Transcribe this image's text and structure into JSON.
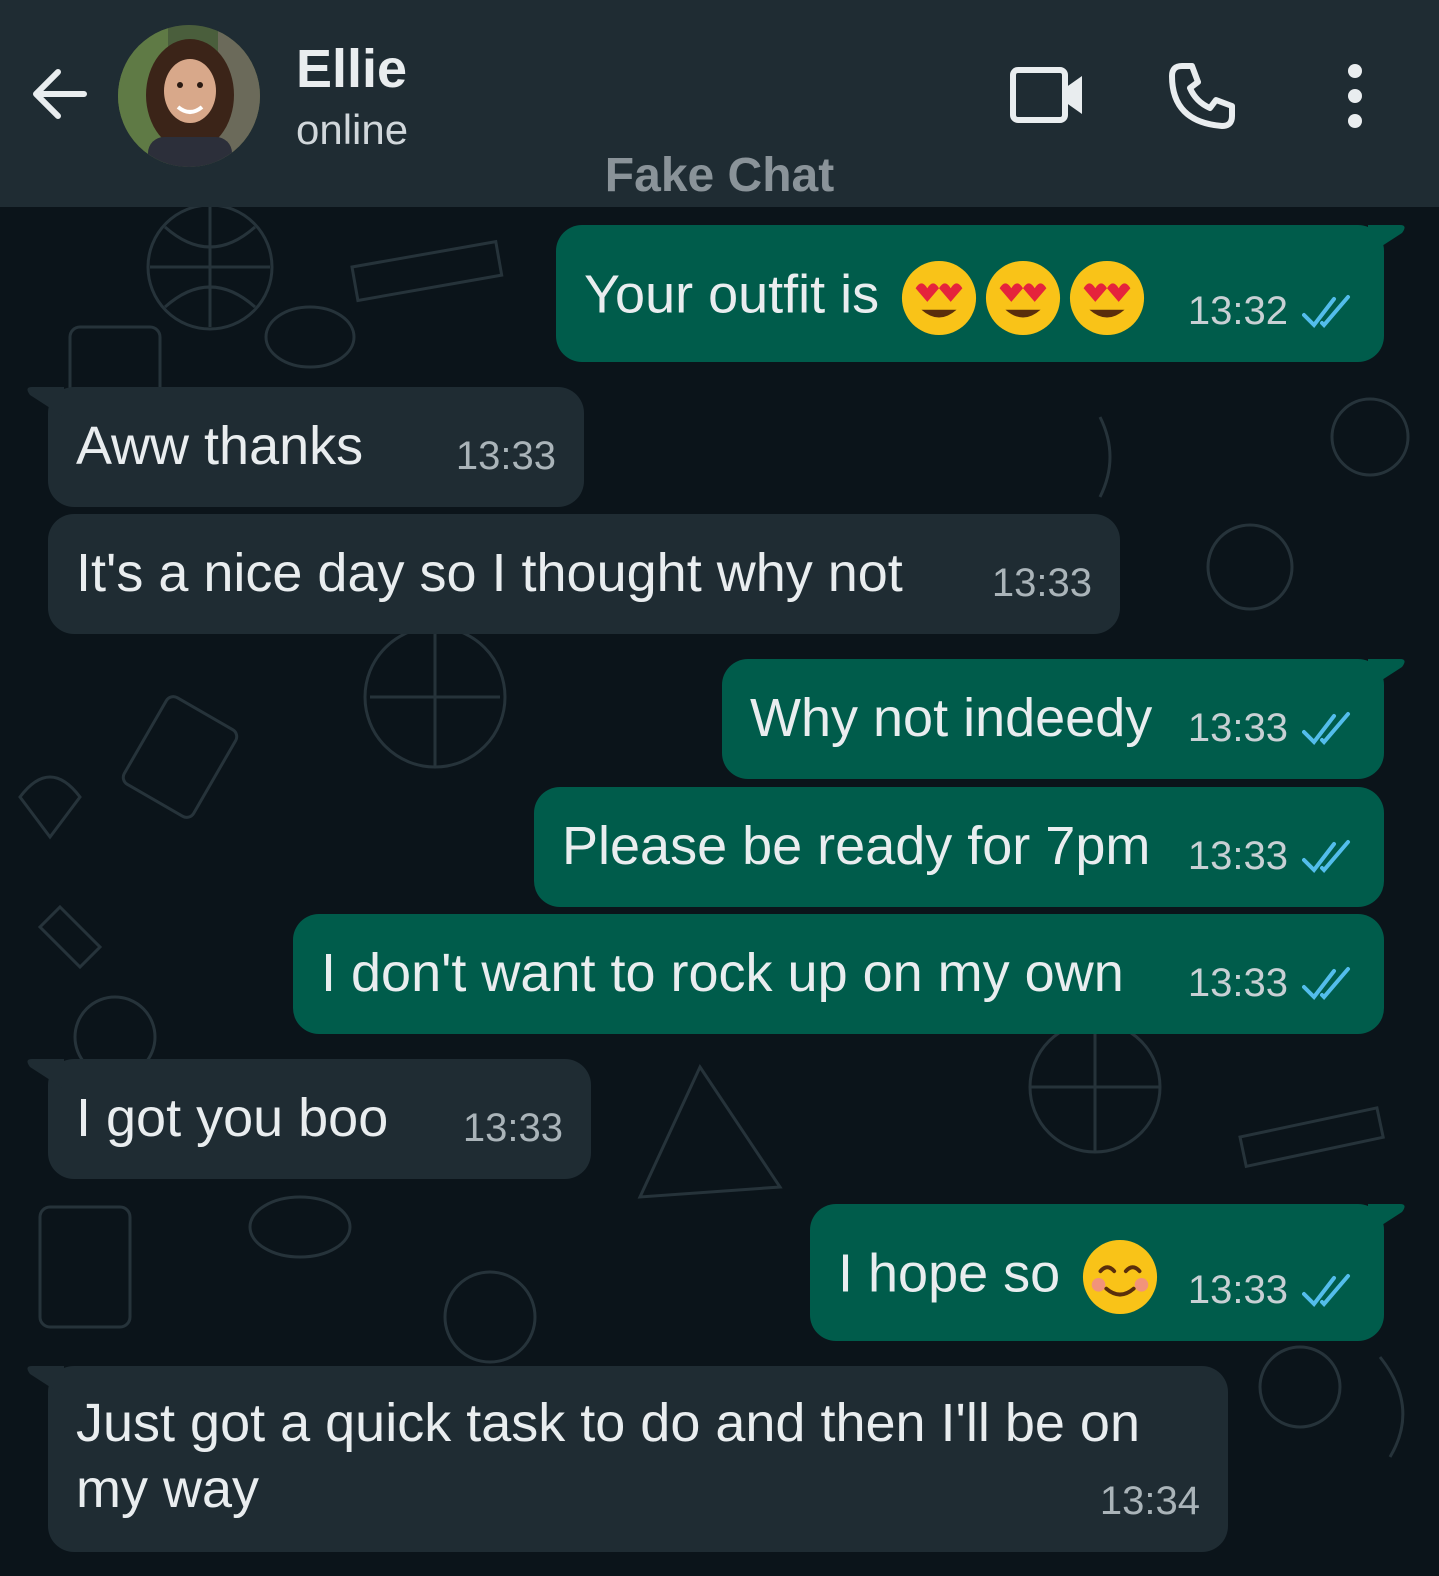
{
  "header": {
    "contact_name": "Ellie",
    "status": "online",
    "watermark": "Fake Chat",
    "icons": [
      "arrow-left-icon",
      "video-camera-icon",
      "phone-icon",
      "more-vertical-icon"
    ]
  },
  "colors": {
    "header_bg": "#1f2c33",
    "chat_bg": "#0b141a",
    "outgoing_bubble": "#005c4b",
    "incoming_bubble": "#1f2c33",
    "read_ticks": "#53bdeb"
  },
  "messages": [
    {
      "direction": "out",
      "text": "Your outfit is",
      "emoji": [
        "heart-eyes-emoji",
        "heart-eyes-emoji",
        "heart-eyes-emoji"
      ],
      "time": "13:32",
      "status": "read"
    },
    {
      "direction": "in",
      "text": "Aww thanks",
      "time": "13:33"
    },
    {
      "direction": "in",
      "text": "It's a nice day so I thought why not",
      "time": "13:33"
    },
    {
      "direction": "out",
      "text": "Why not indeedy",
      "time": "13:33",
      "status": "read"
    },
    {
      "direction": "out",
      "text": "Please be ready for 7pm",
      "time": "13:33",
      "status": "read"
    },
    {
      "direction": "out",
      "text": "I don't want to rock up on my own",
      "time": "13:33",
      "status": "read"
    },
    {
      "direction": "in",
      "text": "I got you boo",
      "time": "13:33"
    },
    {
      "direction": "out",
      "text": "I hope so",
      "emoji": [
        "smiling-face-emoji"
      ],
      "time": "13:33",
      "status": "read"
    },
    {
      "direction": "in",
      "text_line1": "Just got a quick task to do and then I'll be on",
      "text_line2": "my way",
      "time": "13:34"
    }
  ]
}
